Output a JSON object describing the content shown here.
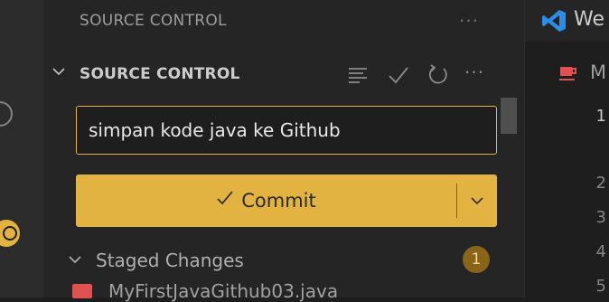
{
  "sidebar": {
    "view_title": "SOURCE CONTROL",
    "more_icon": "ellipsis-icon"
  },
  "section": {
    "title": "SOURCE CONTROL",
    "icons": [
      "view-as-list-icon",
      "check-icon",
      "refresh-icon",
      "ellipsis-icon"
    ]
  },
  "commit": {
    "message_value": "simpan kode java ke Github",
    "button_label": "Commit"
  },
  "staged": {
    "label": "Staged Changes",
    "count": "1",
    "file_label": "MyFirstJavaGithub03.java"
  },
  "editor": {
    "tab_text": "We",
    "file_tab_text": "M",
    "line_numbers": [
      "1",
      "2",
      "3",
      "4",
      "5"
    ]
  },
  "colors": {
    "accent": "#e2b340",
    "sidebar_bg": "#252526",
    "editor_bg": "#1e1e1e",
    "vscode_blue": "#2c8ce6",
    "file_red": "#e05252"
  }
}
